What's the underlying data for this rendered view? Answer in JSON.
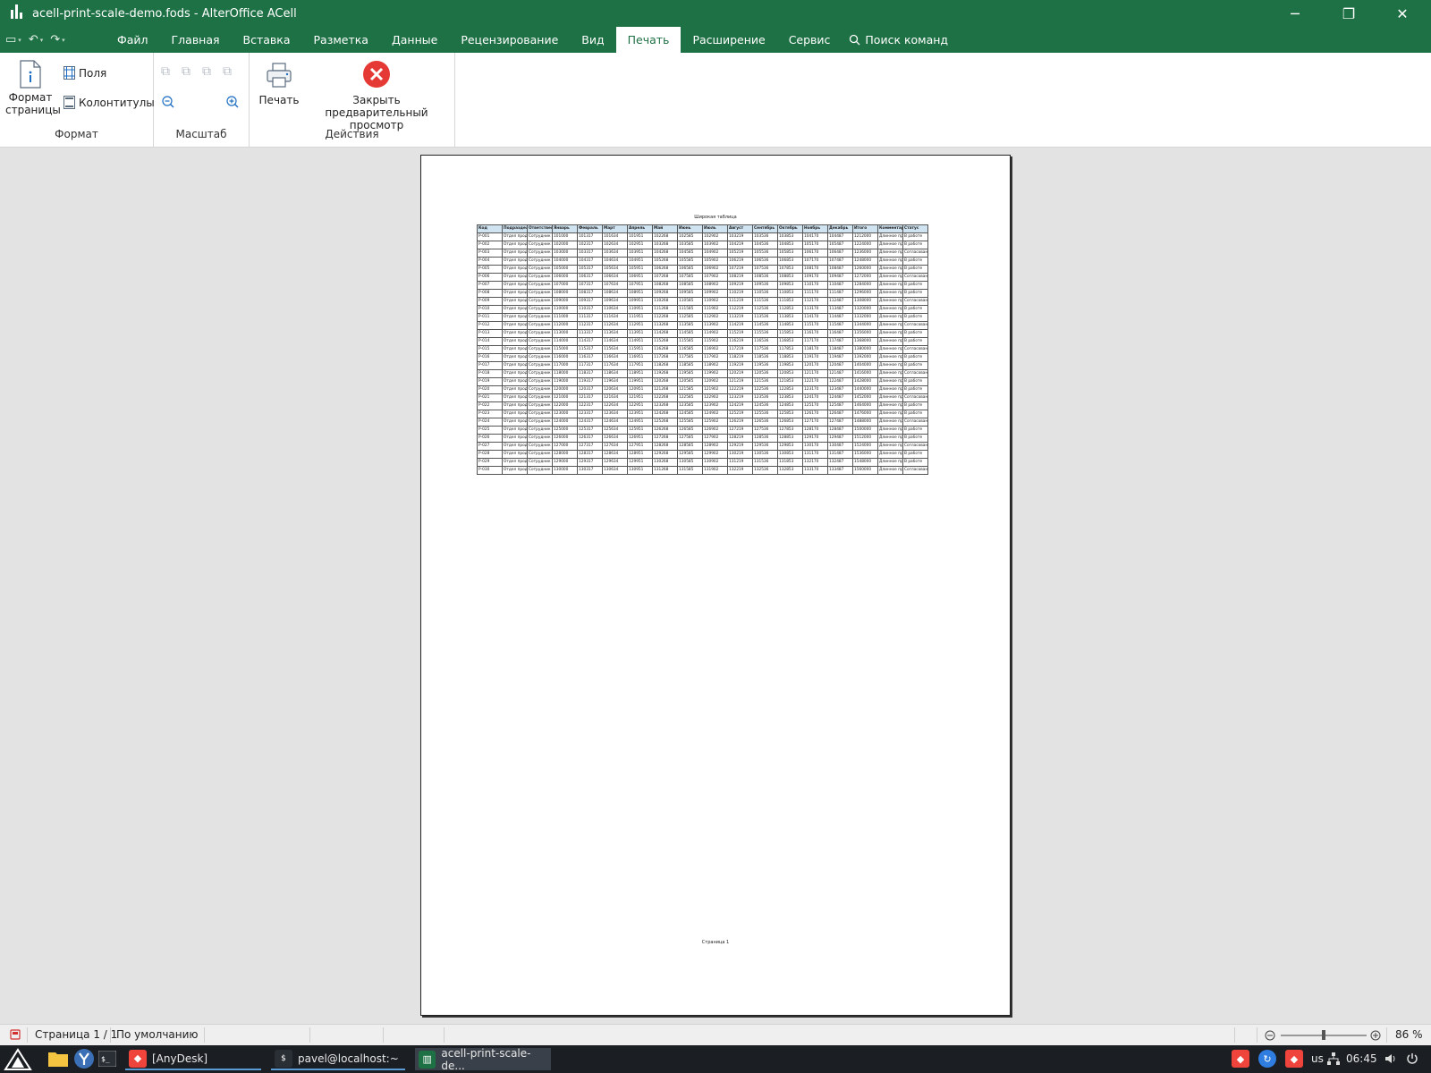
{
  "window": {
    "title": "acell-print-scale-demo.fods - AlterOffice ACell",
    "minimize": "─",
    "maximize": "❐",
    "close": "✕"
  },
  "menu": {
    "items": [
      "Файл",
      "Главная",
      "Вставка",
      "Разметка",
      "Данные",
      "Рецензирование",
      "Вид",
      "Печать",
      "Расширение",
      "Сервис"
    ],
    "active": "Печать",
    "search": "Поиск команд"
  },
  "ribbon": {
    "format": {
      "group": "Формат",
      "page_format_line1": "Формат",
      "page_format_line2": "страницы",
      "fields": "Поля",
      "headers": "Колонтитулы"
    },
    "scale": {
      "group": "Масштаб"
    },
    "actions": {
      "group": "Действия",
      "print": "Печать",
      "close_line1": "Закрыть предварительный",
      "close_line2": "просмотр"
    }
  },
  "sheet": {
    "title": "Широкая таблица",
    "headers": [
      "Код",
      "Подразделение",
      "Ответственный",
      "Январь",
      "Февраль",
      "Март",
      "Апрель",
      "Май",
      "Июнь",
      "Июль",
      "Август",
      "Сентябрь",
      "Октябрь",
      "Ноябрь",
      "Декабрь",
      "Итого",
      "Комментарий",
      "Статус"
    ],
    "rows": [
      [
        "Р-001",
        "Отдел продаж",
        "Сотрудник",
        "101000",
        "101317",
        "101634",
        "101951",
        "102268",
        "102585",
        "102902",
        "103219",
        "103536",
        "103853",
        "104170",
        "104487",
        "1212000",
        "Длинное примечание",
        "В работе"
      ],
      [
        "Р-002",
        "Отдел продаж",
        "Сотрудник",
        "102000",
        "102317",
        "102634",
        "102951",
        "103268",
        "103585",
        "103902",
        "104219",
        "104536",
        "104853",
        "105170",
        "105487",
        "1224000",
        "Длинное примечание",
        "В работе"
      ],
      [
        "Р-003",
        "Отдел продаж",
        "Сотрудник",
        "103000",
        "103317",
        "103634",
        "103951",
        "104268",
        "104585",
        "104902",
        "105219",
        "105536",
        "105853",
        "106170",
        "106487",
        "1236000",
        "Длинное примечание",
        "Согласовано"
      ],
      [
        "Р-004",
        "Отдел продаж",
        "Сотрудник",
        "104000",
        "104317",
        "104634",
        "104951",
        "105268",
        "105585",
        "105902",
        "106219",
        "106536",
        "106853",
        "107170",
        "107487",
        "1248000",
        "Длинное примечание",
        "В работе"
      ],
      [
        "Р-005",
        "Отдел продаж",
        "Сотрудник",
        "105000",
        "105317",
        "105634",
        "105951",
        "106268",
        "106585",
        "106902",
        "107219",
        "107536",
        "107853",
        "108170",
        "108487",
        "1260000",
        "Длинное примечание",
        "В работе"
      ],
      [
        "Р-006",
        "Отдел продаж",
        "Сотрудник",
        "106000",
        "106317",
        "106634",
        "106951",
        "107268",
        "107585",
        "107902",
        "108219",
        "108536",
        "108853",
        "109170",
        "109487",
        "1272000",
        "Длинное примечание",
        "Согласовано"
      ],
      [
        "Р-007",
        "Отдел продаж",
        "Сотрудник",
        "107000",
        "107317",
        "107634",
        "107951",
        "108268",
        "108585",
        "108902",
        "109219",
        "109536",
        "109853",
        "110170",
        "110487",
        "1284000",
        "Длинное примечание",
        "В работе"
      ],
      [
        "Р-008",
        "Отдел продаж",
        "Сотрудник",
        "108000",
        "108317",
        "108634",
        "108951",
        "109268",
        "109585",
        "109902",
        "110219",
        "110536",
        "110853",
        "111170",
        "111487",
        "1296000",
        "Длинное примечание",
        "В работе"
      ],
      [
        "Р-009",
        "Отдел продаж",
        "Сотрудник",
        "109000",
        "109317",
        "109634",
        "109951",
        "110268",
        "110585",
        "110902",
        "111219",
        "111536",
        "111853",
        "112170",
        "112487",
        "1308000",
        "Длинное примечание",
        "Согласовано"
      ],
      [
        "Р-010",
        "Отдел продаж",
        "Сотрудник",
        "110000",
        "110317",
        "110634",
        "110951",
        "111268",
        "111585",
        "111902",
        "112219",
        "112536",
        "112853",
        "113170",
        "113487",
        "1320000",
        "Длинное примечание",
        "В работе"
      ],
      [
        "Р-011",
        "Отдел продаж",
        "Сотрудник",
        "111000",
        "111317",
        "111634",
        "111951",
        "112268",
        "112585",
        "112902",
        "113219",
        "113536",
        "113853",
        "114170",
        "114487",
        "1332000",
        "Длинное примечание",
        "В работе"
      ],
      [
        "Р-012",
        "Отдел продаж",
        "Сотрудник",
        "112000",
        "112317",
        "112634",
        "112951",
        "113268",
        "113585",
        "113902",
        "114219",
        "114536",
        "114853",
        "115170",
        "115487",
        "1344000",
        "Длинное примечание",
        "Согласовано"
      ],
      [
        "Р-013",
        "Отдел продаж",
        "Сотрудник",
        "113000",
        "113317",
        "113634",
        "113951",
        "114268",
        "114585",
        "114902",
        "115219",
        "115536",
        "115853",
        "116170",
        "116487",
        "1356000",
        "Длинное примечание",
        "В работе"
      ],
      [
        "Р-014",
        "Отдел продаж",
        "Сотрудник",
        "114000",
        "114317",
        "114634",
        "114951",
        "115268",
        "115585",
        "115902",
        "116219",
        "116536",
        "116853",
        "117170",
        "117487",
        "1368000",
        "Длинное примечание",
        "В работе"
      ],
      [
        "Р-015",
        "Отдел продаж",
        "Сотрудник",
        "115000",
        "115317",
        "115634",
        "115951",
        "116268",
        "116585",
        "116902",
        "117219",
        "117536",
        "117853",
        "118170",
        "118487",
        "1380000",
        "Длинное примечание",
        "Согласовано"
      ],
      [
        "Р-016",
        "Отдел продаж",
        "Сотрудник",
        "116000",
        "116317",
        "116634",
        "116951",
        "117268",
        "117585",
        "117902",
        "118219",
        "118536",
        "118853",
        "119170",
        "119487",
        "1392000",
        "Длинное примечание",
        "В работе"
      ],
      [
        "Р-017",
        "Отдел продаж",
        "Сотрудник",
        "117000",
        "117317",
        "117634",
        "117951",
        "118268",
        "118585",
        "118902",
        "119219",
        "119536",
        "119853",
        "120170",
        "120487",
        "1404000",
        "Длинное примечание",
        "В работе"
      ],
      [
        "Р-018",
        "Отдел продаж",
        "Сотрудник",
        "118000",
        "118317",
        "118634",
        "118951",
        "119268",
        "119585",
        "119902",
        "120219",
        "120536",
        "120853",
        "121170",
        "121487",
        "1416000",
        "Длинное примечание",
        "Согласовано"
      ],
      [
        "Р-019",
        "Отдел продаж",
        "Сотрудник",
        "119000",
        "119317",
        "119634",
        "119951",
        "120268",
        "120585",
        "120902",
        "121219",
        "121536",
        "121853",
        "122170",
        "122487",
        "1428000",
        "Длинное примечание",
        "В работе"
      ],
      [
        "Р-020",
        "Отдел продаж",
        "Сотрудник",
        "120000",
        "120317",
        "120634",
        "120951",
        "121268",
        "121585",
        "121902",
        "122219",
        "122536",
        "122853",
        "123170",
        "123487",
        "1440000",
        "Длинное примечание",
        "В работе"
      ],
      [
        "Р-021",
        "Отдел продаж",
        "Сотрудник",
        "121000",
        "121317",
        "121634",
        "121951",
        "122268",
        "122585",
        "122902",
        "123219",
        "123536",
        "123853",
        "124170",
        "124487",
        "1452000",
        "Длинное примечание",
        "Согласовано"
      ],
      [
        "Р-022",
        "Отдел продаж",
        "Сотрудник",
        "122000",
        "122317",
        "122634",
        "122951",
        "123268",
        "123585",
        "123902",
        "124219",
        "124536",
        "124853",
        "125170",
        "125487",
        "1464000",
        "Длинное примечание",
        "В работе"
      ],
      [
        "Р-023",
        "Отдел продаж",
        "Сотрудник",
        "123000",
        "123317",
        "123634",
        "123951",
        "124268",
        "124585",
        "124902",
        "125219",
        "125536",
        "125853",
        "126170",
        "126487",
        "1476000",
        "Длинное примечание",
        "В работе"
      ],
      [
        "Р-024",
        "Отдел продаж",
        "Сотрудник",
        "124000",
        "124317",
        "124634",
        "124951",
        "125268",
        "125585",
        "125902",
        "126219",
        "126536",
        "126853",
        "127170",
        "127487",
        "1488000",
        "Длинное примечание",
        "Согласовано"
      ],
      [
        "Р-025",
        "Отдел продаж",
        "Сотрудник",
        "125000",
        "125317",
        "125634",
        "125951",
        "126268",
        "126585",
        "126902",
        "127219",
        "127536",
        "127853",
        "128170",
        "128487",
        "1500000",
        "Длинное примечание",
        "В работе"
      ],
      [
        "Р-026",
        "Отдел продаж",
        "Сотрудник",
        "126000",
        "126317",
        "126634",
        "126951",
        "127268",
        "127585",
        "127902",
        "128219",
        "128536",
        "128853",
        "129170",
        "129487",
        "1512000",
        "Длинное примечание",
        "В работе"
      ],
      [
        "Р-027",
        "Отдел продаж",
        "Сотрудник",
        "127000",
        "127317",
        "127634",
        "127951",
        "128268",
        "128585",
        "128902",
        "129219",
        "129536",
        "129853",
        "130170",
        "130487",
        "1524000",
        "Длинное примечание",
        "Согласовано"
      ],
      [
        "Р-028",
        "Отдел продаж",
        "Сотрудник",
        "128000",
        "128317",
        "128634",
        "128951",
        "129268",
        "129585",
        "129902",
        "130219",
        "130536",
        "130853",
        "131170",
        "131487",
        "1536000",
        "Длинное примечание",
        "В работе"
      ],
      [
        "Р-029",
        "Отдел продаж",
        "Сотрудник",
        "129000",
        "129317",
        "129634",
        "129951",
        "130268",
        "130585",
        "130902",
        "131219",
        "131536",
        "131853",
        "132170",
        "132487",
        "1548000",
        "Длинное примечание",
        "В работе"
      ],
      [
        "Р-030",
        "Отдел продаж",
        "Сотрудник",
        "130000",
        "130317",
        "130634",
        "130951",
        "131268",
        "131585",
        "131902",
        "132219",
        "132536",
        "132853",
        "133170",
        "133487",
        "1560000",
        "Длинное примечание",
        "Согласовано"
      ]
    ],
    "footer": "Страница 1"
  },
  "status": {
    "page": "Страница 1 / 1",
    "style": "По умолчанию",
    "zoom": "86 %",
    "zoom_level": 0.5
  },
  "taskbar": {
    "anydesk": "[AnyDesk]",
    "terminal": "pavel@localhost:~",
    "acell": "acell-print-scale-de...",
    "lang": "us",
    "clock": "06:45"
  },
  "colors": {
    "brand": "#1e7145",
    "close_preview": "#e53935",
    "anydesk": "#ef443b"
  }
}
